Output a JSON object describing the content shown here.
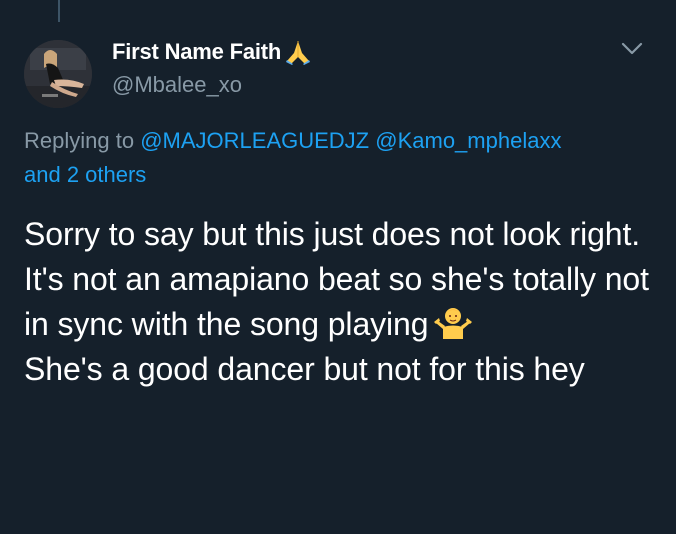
{
  "tweet": {
    "display_name": "First Name Faith",
    "handle": "@Mbalee_xo",
    "replying_prefix": "Replying to",
    "mentions": [
      "@MAJORLEAGUEDJZ",
      "@Kamo_mphelaxx"
    ],
    "and_others": "and 2 others",
    "text_line1": "Sorry to say but this just does not look right. It's not an amapiano beat so she's totally not in sync with the song playing",
    "text_line2": "She's a good dancer but not for this hey"
  },
  "icons": {
    "name_emoji": "folded-hands-icon",
    "text_emoji": "person-shrugging-icon",
    "menu": "chevron-down-icon"
  },
  "colors": {
    "background": "#15202b",
    "text_primary": "#ffffff",
    "text_secondary": "#8899a6",
    "link": "#1da1f2"
  }
}
